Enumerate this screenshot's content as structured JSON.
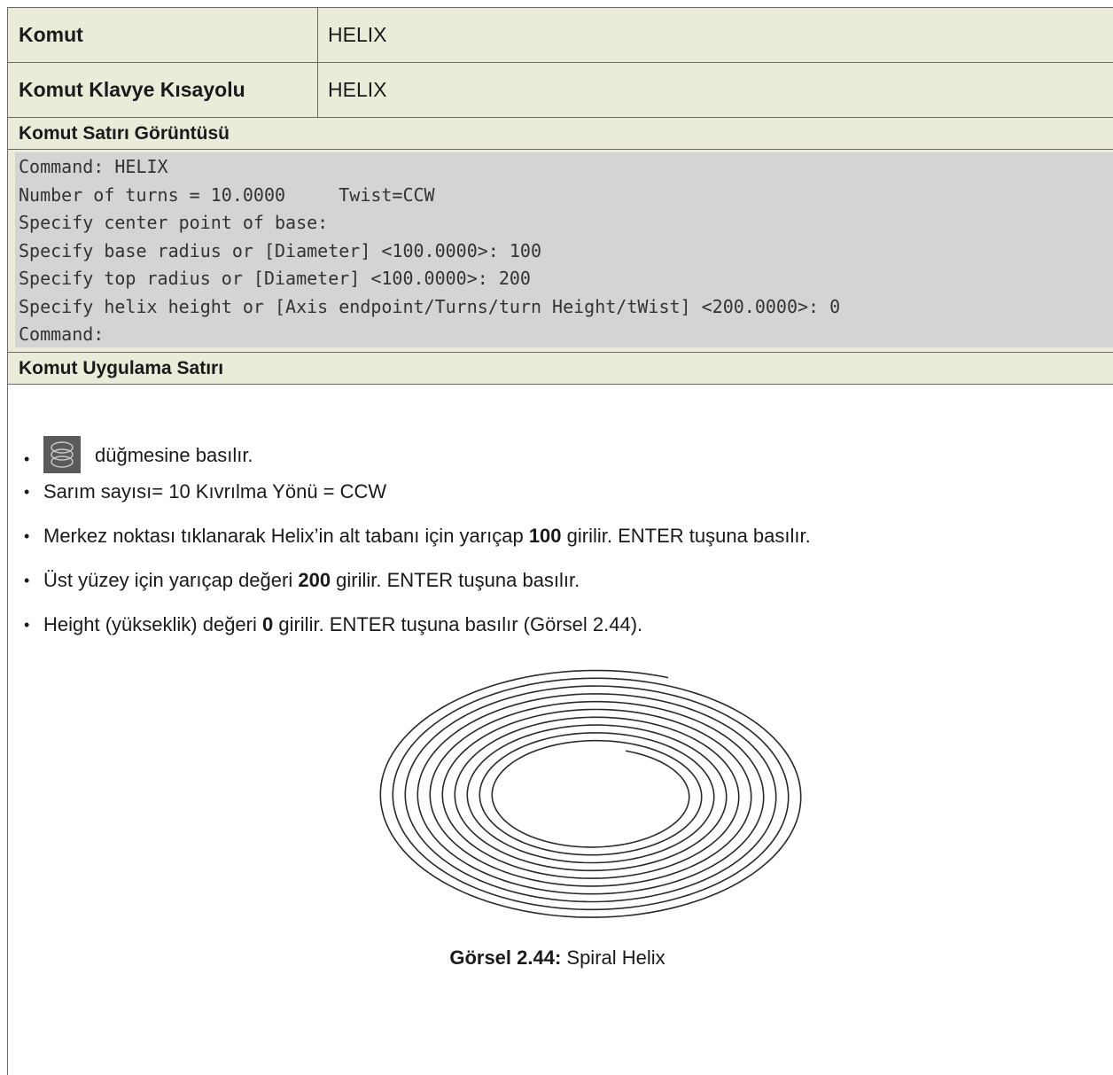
{
  "table": {
    "command_key": "Komut",
    "command_value": "HELIX",
    "shortcut_key": "Komut Klavye Kısayolu",
    "shortcut_value": "HELIX",
    "cmdline_header": "Komut Satırı Görüntüsü",
    "cmdline_lines": [
      "Command: HELIX",
      "Number of turns = 10.0000     Twist=CCW",
      "Specify center point of base:",
      "Specify base radius or [Diameter] <100.0000>: 100",
      "Specify top radius or [Diameter] <100.0000>: 200",
      "Specify helix height or [Axis endpoint/Turns/turn Height/tWist] <200.0000>: 0",
      "Command:"
    ],
    "apply_header": "Komut Uygulama Satırı"
  },
  "steps": {
    "bullet": "•",
    "s1": "düğmesine basılır.",
    "s2": "Sarım sayısı= 10 Kıvrılma Yönü = CCW",
    "s3_a": "Merkez noktası tıklanarak Helix’in alt tabanı için yarıçap ",
    "s3_b": "100",
    "s3_c": " girilir. ENTER tuşuna basılır.",
    "s4_a": "Üst yüzey için yarıçap değeri ",
    "s4_b": "200",
    "s4_c": " girilir. ENTER tuşuna basılır.",
    "s5_a": "Height (yükseklik) değeri ",
    "s5_b": "0",
    "s5_c": " girilir. ENTER tuşuna basılır (Görsel 2.44)."
  },
  "icons": {
    "helix_button": "helix-icon"
  },
  "figure": {
    "caption_label": "Görsel 2.44:",
    "caption_text": " Spiral Helix"
  }
}
